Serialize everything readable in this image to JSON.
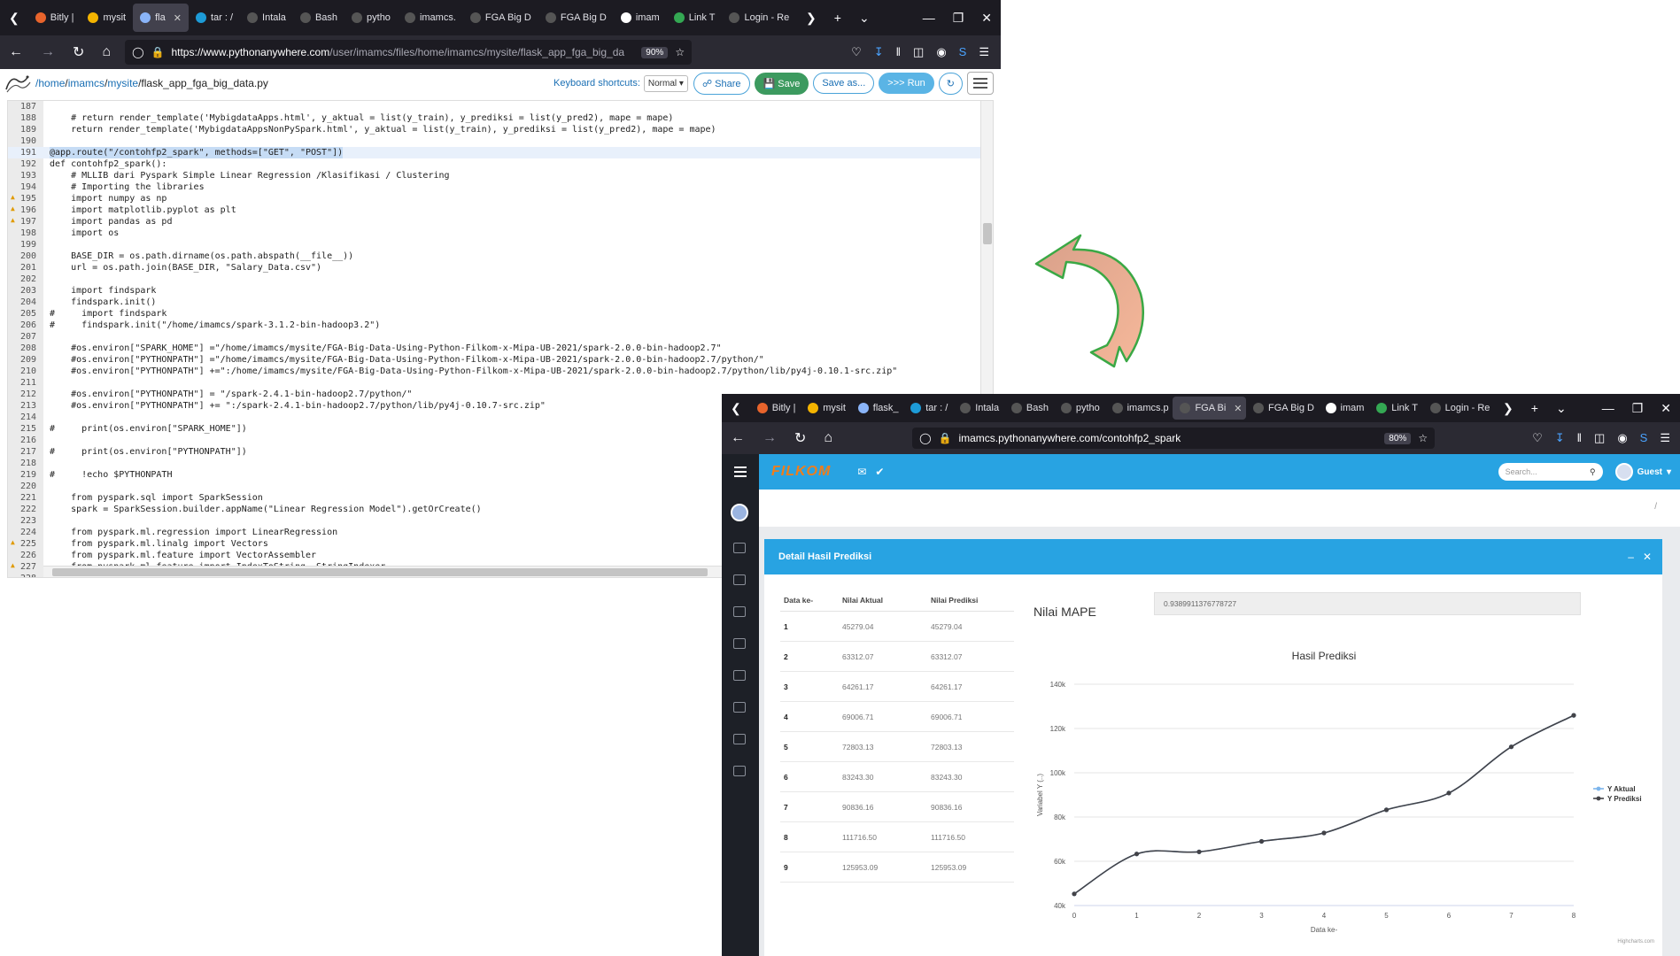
{
  "editor_window": {
    "tabs": [
      {
        "label": "Bitly |",
        "color": "#e8642c",
        "active": false
      },
      {
        "label": "mysit",
        "color": "#f4b400",
        "active": false
      },
      {
        "label": "fla",
        "color": "#8ab4f8",
        "active": true
      },
      {
        "label": "tar : /",
        "color": "#1d9bd7",
        "active": false
      },
      {
        "label": "Intala",
        "color": "#555555",
        "active": false
      },
      {
        "label": "Bash",
        "color": "#555555",
        "active": false
      },
      {
        "label": "pytho",
        "color": "#555555",
        "active": false
      },
      {
        "label": "imamcs.",
        "color": "#555555",
        "active": false
      },
      {
        "label": "FGA Big D",
        "color": "#555555",
        "active": false
      },
      {
        "label": "FGA Big D",
        "color": "#555555",
        "active": false
      },
      {
        "label": "imam",
        "color": "#ffffff",
        "active": false
      },
      {
        "label": "Link T",
        "color": "#34a853",
        "active": false
      },
      {
        "label": "Login - Re",
        "color": "#555555",
        "active": false
      }
    ],
    "url_host": "https://www.pythonanywhere.com",
    "url_path": "/user/imamcs/files/home/imamcs/mysite/flask_app_fga_big_da",
    "zoom": "90%"
  },
  "editor": {
    "breadcrumb": {
      "sep": "/",
      "home": "home",
      "user": "imamcs",
      "dir": "mysite",
      "file": "flask_app_fga_big_data.py"
    },
    "keyboard_label": "Keyboard shortcuts:",
    "keyboard_mode": "Normal",
    "share": "Share",
    "save": "Save",
    "save_as": "Save as...",
    "run": ">>> Run",
    "lines": [
      {
        "n": "187",
        "t": "",
        "w": false
      },
      {
        "n": "188",
        "t": "    # return render_template('MybigdataApps.html', y_aktual = list(y_train), y_prediksi = list(y_pred2), mape = mape)",
        "w": false
      },
      {
        "n": "189",
        "t": "    return render_template('MybigdataAppsNonPySpark.html', y_aktual = list(y_train), y_prediksi = list(y_pred2), mape = mape)",
        "w": false
      },
      {
        "n": "190",
        "t": "",
        "w": false
      },
      {
        "n": "191",
        "t": "@app.route(\"/contohfp2_spark\", methods=[\"GET\", \"POST\"])",
        "w": false,
        "hl": true
      },
      {
        "n": "192",
        "t": "def contohfp2_spark():",
        "w": false
      },
      {
        "n": "193",
        "t": "    # MLLIB dari Pyspark Simple Linear Regression /Klasifikasi / Clustering",
        "w": false
      },
      {
        "n": "194",
        "t": "    # Importing the libraries",
        "w": false
      },
      {
        "n": "195",
        "t": "    import numpy as np",
        "w": true
      },
      {
        "n": "196",
        "t": "    import matplotlib.pyplot as plt",
        "w": true
      },
      {
        "n": "197",
        "t": "    import pandas as pd",
        "w": true
      },
      {
        "n": "198",
        "t": "    import os",
        "w": false
      },
      {
        "n": "199",
        "t": "",
        "w": false
      },
      {
        "n": "200",
        "t": "    BASE_DIR = os.path.dirname(os.path.abspath(__file__))",
        "w": false
      },
      {
        "n": "201",
        "t": "    url = os.path.join(BASE_DIR, \"Salary_Data.csv\")",
        "w": false
      },
      {
        "n": "202",
        "t": "",
        "w": false
      },
      {
        "n": "203",
        "t": "    import findspark",
        "w": false
      },
      {
        "n": "204",
        "t": "    findspark.init()",
        "w": false
      },
      {
        "n": "205",
        "t": "#     import findspark",
        "w": false
      },
      {
        "n": "206",
        "t": "#     findspark.init(\"/home/imamcs/spark-3.1.2-bin-hadoop3.2\")",
        "w": false
      },
      {
        "n": "207",
        "t": "",
        "w": false
      },
      {
        "n": "208",
        "t": "    #os.environ[\"SPARK_HOME\"] =\"/home/imamcs/mysite/FGA-Big-Data-Using-Python-Filkom-x-Mipa-UB-2021/spark-2.0.0-bin-hadoop2.7\"",
        "w": false
      },
      {
        "n": "209",
        "t": "    #os.environ[\"PYTHONPATH\"] =\"/home/imamcs/mysite/FGA-Big-Data-Using-Python-Filkom-x-Mipa-UB-2021/spark-2.0.0-bin-hadoop2.7/python/\"",
        "w": false
      },
      {
        "n": "210",
        "t": "    #os.environ[\"PYTHONPATH\"] +=\":/home/imamcs/mysite/FGA-Big-Data-Using-Python-Filkom-x-Mipa-UB-2021/spark-2.0.0-bin-hadoop2.7/python/lib/py4j-0.10.1-src.zip\"",
        "w": false
      },
      {
        "n": "211",
        "t": "",
        "w": false
      },
      {
        "n": "212",
        "t": "    #os.environ[\"PYTHONPATH\"] = \"/spark-2.4.1-bin-hadoop2.7/python/\"",
        "w": false
      },
      {
        "n": "213",
        "t": "    #os.environ[\"PYTHONPATH\"] += \":/spark-2.4.1-bin-hadoop2.7/python/lib/py4j-0.10.7-src.zip\"",
        "w": false
      },
      {
        "n": "214",
        "t": "",
        "w": false
      },
      {
        "n": "215",
        "t": "#     print(os.environ[\"SPARK_HOME\"])",
        "w": false
      },
      {
        "n": "216",
        "t": "",
        "w": false
      },
      {
        "n": "217",
        "t": "#     print(os.environ[\"PYTHONPATH\"])",
        "w": false
      },
      {
        "n": "218",
        "t": "",
        "w": false
      },
      {
        "n": "219",
        "t": "#     !echo $PYTHONPATH",
        "w": false
      },
      {
        "n": "220",
        "t": "",
        "w": false
      },
      {
        "n": "221",
        "t": "    from pyspark.sql import SparkSession",
        "w": false
      },
      {
        "n": "222",
        "t": "    spark = SparkSession.builder.appName(\"Linear Regression Model\").getOrCreate()",
        "w": false
      },
      {
        "n": "223",
        "t": "",
        "w": false
      },
      {
        "n": "224",
        "t": "    from pyspark.ml.regression import LinearRegression",
        "w": false
      },
      {
        "n": "225",
        "t": "    from pyspark.ml.linalg import Vectors",
        "w": true
      },
      {
        "n": "226",
        "t": "    from pyspark.ml.feature import VectorAssembler",
        "w": false
      },
      {
        "n": "227",
        "t": "    from pyspark.ml.feature import IndexToString, StringIndexer",
        "w": true
      },
      {
        "n": "228",
        "t": "",
        "w": false
      }
    ]
  },
  "result_window": {
    "tabs": [
      {
        "label": "Bitly |",
        "color": "#e8642c",
        "active": false
      },
      {
        "label": "mysit",
        "color": "#f4b400",
        "active": false
      },
      {
        "label": "flask_",
        "color": "#8ab4f8",
        "active": false
      },
      {
        "label": "tar : /",
        "color": "#1d9bd7",
        "active": false
      },
      {
        "label": "Intala",
        "color": "#555555",
        "active": false
      },
      {
        "label": "Bash",
        "color": "#555555",
        "active": false
      },
      {
        "label": "pytho",
        "color": "#555555",
        "active": false
      },
      {
        "label": "imamcs.p",
        "color": "#555555",
        "active": false
      },
      {
        "label": "FGA Bi",
        "color": "#555555",
        "active": true
      },
      {
        "label": "FGA Big D",
        "color": "#555555",
        "active": false
      },
      {
        "label": "imam",
        "color": "#ffffff",
        "active": false
      },
      {
        "label": "Link T",
        "color": "#34a853",
        "active": false
      },
      {
        "label": "Login - Re",
        "color": "#555555",
        "active": false
      }
    ],
    "url_host": "imamcs.pythonanywhere.com",
    "url_path": "/contohfp2_spark",
    "zoom": "80%"
  },
  "app": {
    "brand": "FILKOM",
    "search_placeholder": "Search...",
    "user": "Guest",
    "breadcrumb_slash": "/",
    "card_title": "Detail Hasil Prediksi",
    "table_headers": [
      "Data ke-",
      "Nilai Aktual",
      "Nilai Prediksi"
    ],
    "rows": [
      [
        "1",
        "45279.04",
        "45279.04"
      ],
      [
        "2",
        "63312.07",
        "63312.07"
      ],
      [
        "3",
        "64261.17",
        "64261.17"
      ],
      [
        "4",
        "69006.71",
        "69006.71"
      ],
      [
        "5",
        "72803.13",
        "72803.13"
      ],
      [
        "6",
        "83243.30",
        "83243.30"
      ],
      [
        "7",
        "90836.16",
        "90836.16"
      ],
      [
        "8",
        "111716.50",
        "111716.50"
      ],
      [
        "9",
        "125953.09",
        "125953.09"
      ]
    ],
    "mape_label": "Nilai MAPE",
    "mape_value": "0.9389911376778727"
  },
  "chart_data": {
    "type": "line",
    "title": "Hasil Prediksi",
    "xlabel": "Data ke-",
    "ylabel": "Variabel Y (..)",
    "x": [
      0,
      1,
      2,
      3,
      4,
      5,
      6,
      7,
      8
    ],
    "series": [
      {
        "name": "Y Aktual",
        "values": [
          45279.04,
          63312.07,
          64261.17,
          69006.71,
          72803.13,
          83243.3,
          90836.16,
          111716.5,
          125953.09
        ],
        "color": "#7cb5ec"
      },
      {
        "name": "Y Prediksi",
        "values": [
          45279.04,
          63312.07,
          64261.17,
          69006.71,
          72803.13,
          83243.3,
          90836.16,
          111716.5,
          125953.09
        ],
        "color": "#434348"
      }
    ],
    "ylim": [
      40000,
      140000
    ],
    "yticks": [
      40000,
      60000,
      80000,
      100000,
      120000,
      140000
    ],
    "ytick_labels": [
      "40k",
      "60k",
      "80k",
      "100k",
      "120k",
      "140k"
    ],
    "xticks": [
      "0",
      "1",
      "2",
      "3",
      "4",
      "5",
      "6",
      "7",
      "8"
    ],
    "legend_position": "right",
    "credits": "Highcharts.com"
  }
}
